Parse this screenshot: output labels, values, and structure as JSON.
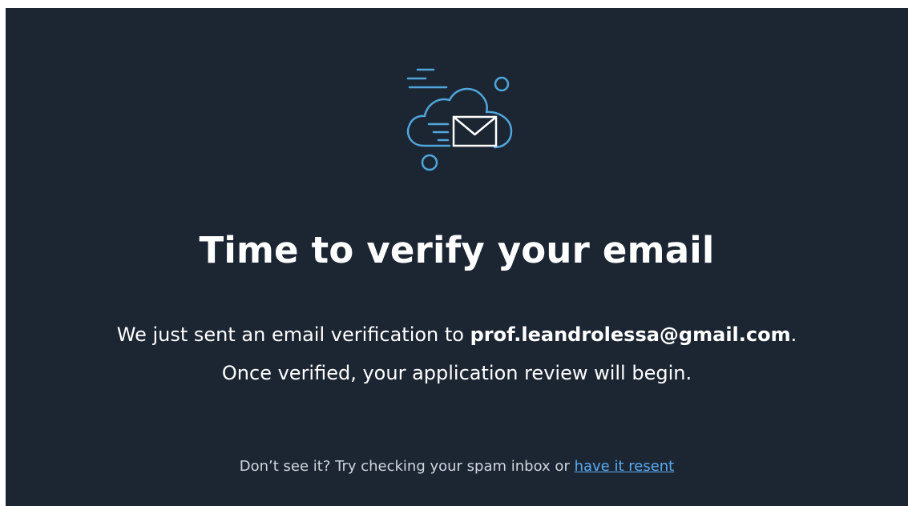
{
  "icon": "cloud-email-icon",
  "colors": {
    "background": "#1c2633",
    "accent": "#5aaaf2",
    "icon_stroke": "#4fa6dc"
  },
  "title": "Time to verify your email",
  "message": {
    "prefix": "We just sent an email verification to ",
    "email": "prof.leandrolessa@gmail.com",
    "suffix": ".",
    "line2": "Once verified, your application review will begin."
  },
  "footer": {
    "text": "Don’t see it? Try checking your spam inbox or ",
    "link_label": "have it resent"
  }
}
